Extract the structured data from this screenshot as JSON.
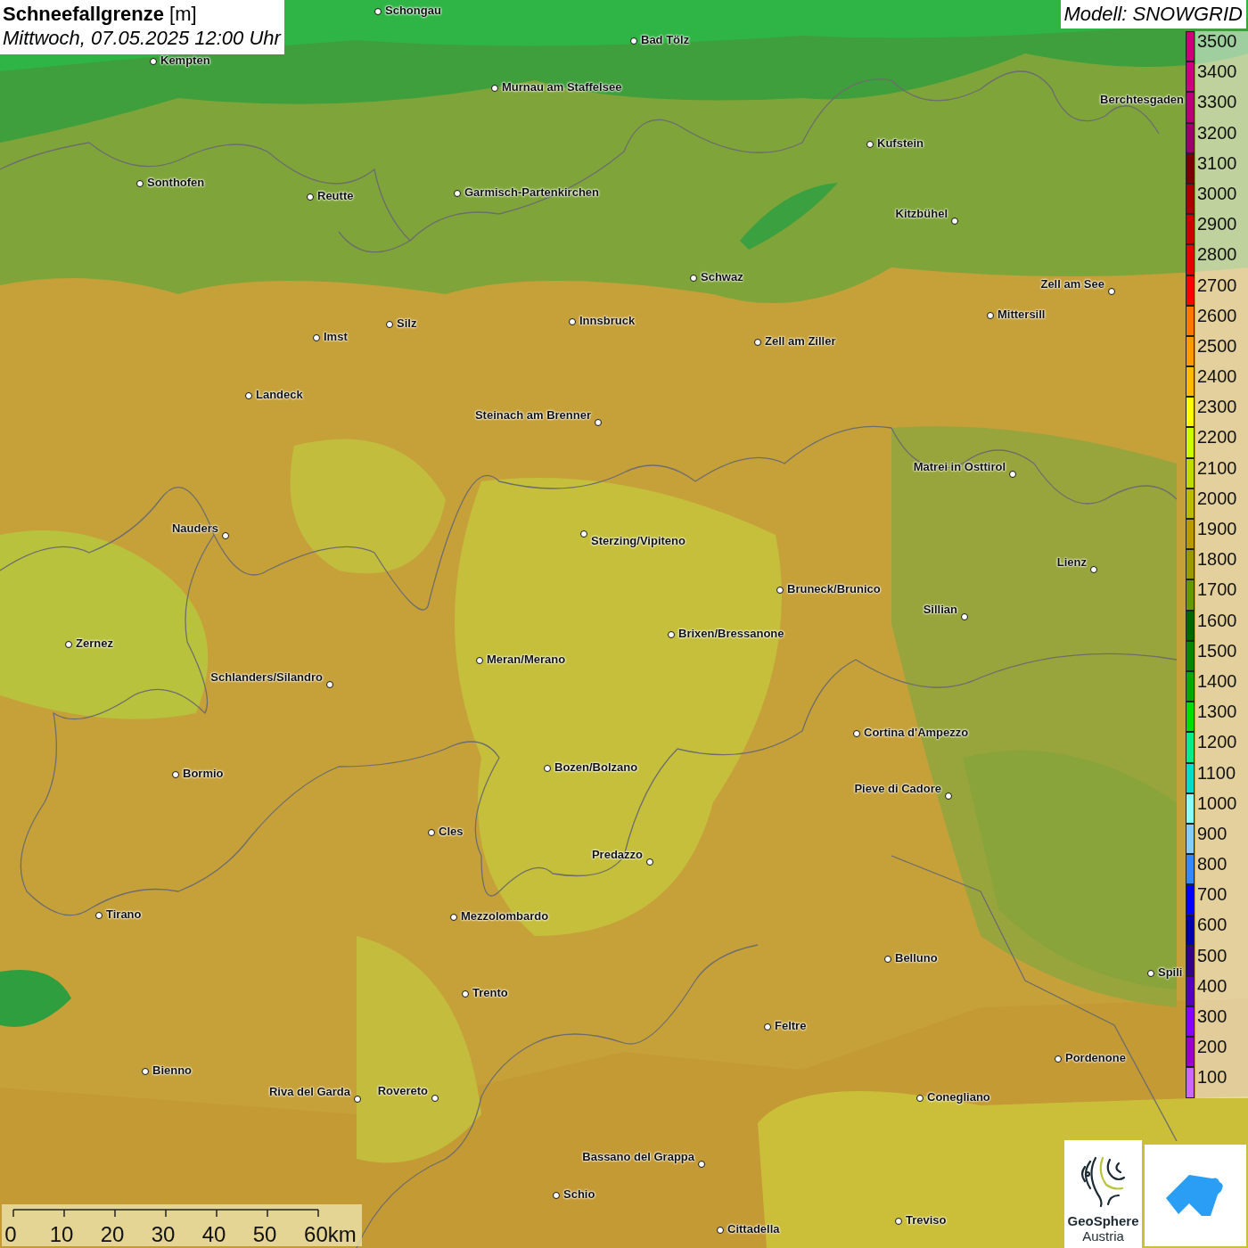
{
  "title": {
    "heading": "**Schneefallgrenze** [m]",
    "subtitle": "Mittwoch, 07.05.2025 12:00 Uhr"
  },
  "model": "Modell: SNOWGRID",
  "cities": [
    {
      "name": "Schongau"
    },
    {
      "name": "Bad Tölz"
    },
    {
      "name": "Kempten"
    },
    {
      "name": "Murnau am Staffelsee"
    },
    {
      "name": "Berchtesgaden"
    },
    {
      "name": "Kufstein"
    },
    {
      "name": "Sonthofen"
    },
    {
      "name": "Reutte"
    },
    {
      "name": "Garmisch-Partenkirchen"
    },
    {
      "name": "Kitzbühel"
    },
    {
      "name": "Schwaz"
    },
    {
      "name": "Zell am See"
    },
    {
      "name": "Innsbruck"
    },
    {
      "name": "Mittersill"
    },
    {
      "name": "Silz"
    },
    {
      "name": "Imst"
    },
    {
      "name": "Zell am Ziller"
    },
    {
      "name": "Landeck"
    },
    {
      "name": "Steinach am Brenner"
    },
    {
      "name": "Matrei in Osttirol"
    },
    {
      "name": "Nauders"
    },
    {
      "name": "Sterzing/Vipiteno"
    },
    {
      "name": "Lienz"
    },
    {
      "name": "Bruneck/Brunico"
    },
    {
      "name": "Sillian"
    },
    {
      "name": "Brixen/Bressanone"
    },
    {
      "name": "Zernez"
    },
    {
      "name": "Meran/Merano"
    },
    {
      "name": "Schlanders/Silandro"
    },
    {
      "name": "Cortina d'Ampezzo"
    },
    {
      "name": "Bozen/Bolzano"
    },
    {
      "name": "Bormio"
    },
    {
      "name": "Pieve di Cadore"
    },
    {
      "name": "Cles"
    },
    {
      "name": "Predazzo"
    },
    {
      "name": "Tirano"
    },
    {
      "name": "Mezzolombardo"
    },
    {
      "name": "Belluno"
    },
    {
      "name": "Spili"
    },
    {
      "name": "Trento"
    },
    {
      "name": "Feltre"
    },
    {
      "name": "Pordenone"
    },
    {
      "name": "Bienno"
    },
    {
      "name": "Riva del Garda"
    },
    {
      "name": "Rovereto"
    },
    {
      "name": "Conegliano"
    },
    {
      "name": "Bassano del Grappa"
    },
    {
      "name": "Schio"
    },
    {
      "name": "Treviso"
    },
    {
      "name": "Cittadella"
    }
  ],
  "legend": [
    {
      "label": "3500",
      "color": "#cc0077"
    },
    {
      "label": "3400",
      "color": "#cc0080"
    },
    {
      "label": "3300",
      "color": "#b8007a"
    },
    {
      "label": "3200",
      "color": "#99006e"
    },
    {
      "label": "3100",
      "color": "#7a0000"
    },
    {
      "label": "3000",
      "color": "#aa0000"
    },
    {
      "label": "2900",
      "color": "#cc0000"
    },
    {
      "label": "2800",
      "color": "#e60000"
    },
    {
      "label": "2700",
      "color": "#ff0000"
    },
    {
      "label": "2600",
      "color": "#ff7700"
    },
    {
      "label": "2500",
      "color": "#ff9900"
    },
    {
      "label": "2400",
      "color": "#ffbb00"
    },
    {
      "label": "2300",
      "color": "#ffff00"
    },
    {
      "label": "2200",
      "color": "#ccff00"
    },
    {
      "label": "2100",
      "color": "#bbdd00"
    },
    {
      "label": "2000",
      "color": "#bbbb00"
    },
    {
      "label": "1900",
      "color": "#bb9900"
    },
    {
      "label": "1800",
      "color": "#999900"
    },
    {
      "label": "1700",
      "color": "#669900"
    },
    {
      "label": "1600",
      "color": "#006600"
    },
    {
      "label": "1500",
      "color": "#008800"
    },
    {
      "label": "1400",
      "color": "#00aa00"
    },
    {
      "label": "1300",
      "color": "#00dd00"
    },
    {
      "label": "1200",
      "color": "#00ee88"
    },
    {
      "label": "1100",
      "color": "#00ddcc"
    },
    {
      "label": "1000",
      "color": "#88ffff"
    },
    {
      "label": "900",
      "color": "#88ccff"
    },
    {
      "label": "800",
      "color": "#3388ff"
    },
    {
      "label": "700",
      "color": "#0000ff"
    },
    {
      "label": "600",
      "color": "#0000aa"
    },
    {
      "label": "500",
      "color": "#330088"
    },
    {
      "label": "400",
      "color": "#5500bb"
    },
    {
      "label": "300",
      "color": "#8800ff"
    },
    {
      "label": "200",
      "color": "#9900cc"
    },
    {
      "label": "100",
      "color": "#cc66ff"
    }
  ],
  "scale_bar": {
    "labels": [
      "0",
      "10",
      "20",
      "30",
      "40",
      "50",
      "60km"
    ]
  },
  "logo": {
    "name": "GeoSphere",
    "country": "Austria"
  }
}
